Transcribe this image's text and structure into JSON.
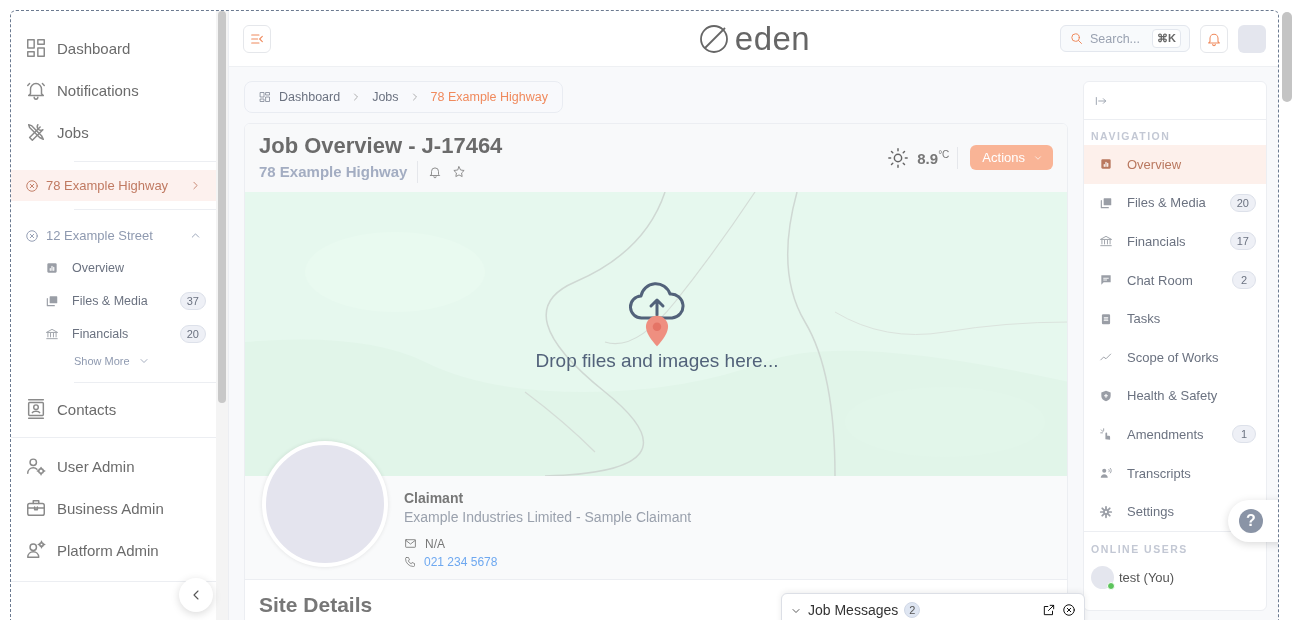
{
  "sidebar": {
    "main_items": [
      {
        "label": "Dashboard"
      },
      {
        "label": "Notifications"
      },
      {
        "label": "Jobs"
      }
    ],
    "open_jobs": [
      {
        "label": "78 Example Highway",
        "selected": true,
        "expanded": false
      },
      {
        "label": "12 Example Street",
        "selected": false,
        "expanded": true,
        "children": [
          {
            "label": "Overview"
          },
          {
            "label": "Files & Media",
            "count": "37"
          },
          {
            "label": "Financials",
            "count": "20"
          }
        ],
        "show_more": "Show More"
      }
    ],
    "contacts": {
      "label": "Contacts"
    },
    "admin_items": [
      {
        "label": "User Admin"
      },
      {
        "label": "Business Admin"
      },
      {
        "label": "Platform Admin"
      }
    ]
  },
  "top_bar": {
    "logo": "eden",
    "search": {
      "placeholder": "Search...",
      "shortcut": "⌘K"
    }
  },
  "breadcrumb": [
    {
      "label": "Dashboard",
      "selected": false
    },
    {
      "label": "Jobs",
      "selected": false
    },
    {
      "label": "78 Example Highway",
      "selected": true
    }
  ],
  "job": {
    "title": "Job Overview - J-17464",
    "subtitle": "78 Example Highway",
    "temperature": "8.9",
    "unit": "°C",
    "actions": "Actions",
    "dropzone": "Drop files and images here...",
    "claimant": {
      "heading": "Claimant",
      "name": "Example Industries Limited - Sample Claimant",
      "email": "N/A",
      "phone": "021 234 5678"
    },
    "section_title": "Site Details"
  },
  "right_panel": {
    "navigation": {
      "heading": "NAVIGATION",
      "items": [
        {
          "label": "Overview",
          "selected": true
        },
        {
          "label": "Files & Media",
          "selected": false,
          "count": "20"
        },
        {
          "label": "Financials",
          "selected": false,
          "count": "17"
        },
        {
          "label": "Chat Room",
          "selected": false,
          "count": "2"
        },
        {
          "label": "Tasks",
          "selected": false
        },
        {
          "label": "Scope of Works",
          "selected": false
        },
        {
          "label": "Health & Safety",
          "selected": false
        },
        {
          "label": "Amendments",
          "selected": false,
          "count": "1"
        },
        {
          "label": "Transcripts",
          "selected": false
        },
        {
          "label": "Settings",
          "selected": false
        }
      ]
    },
    "online_users": {
      "heading": "ONLINE USERS",
      "users": [
        {
          "name": "test (You)",
          "online": true
        }
      ]
    }
  },
  "help": {
    "label": "?"
  },
  "job_messages": {
    "title": "Job Messages",
    "count": "2"
  }
}
